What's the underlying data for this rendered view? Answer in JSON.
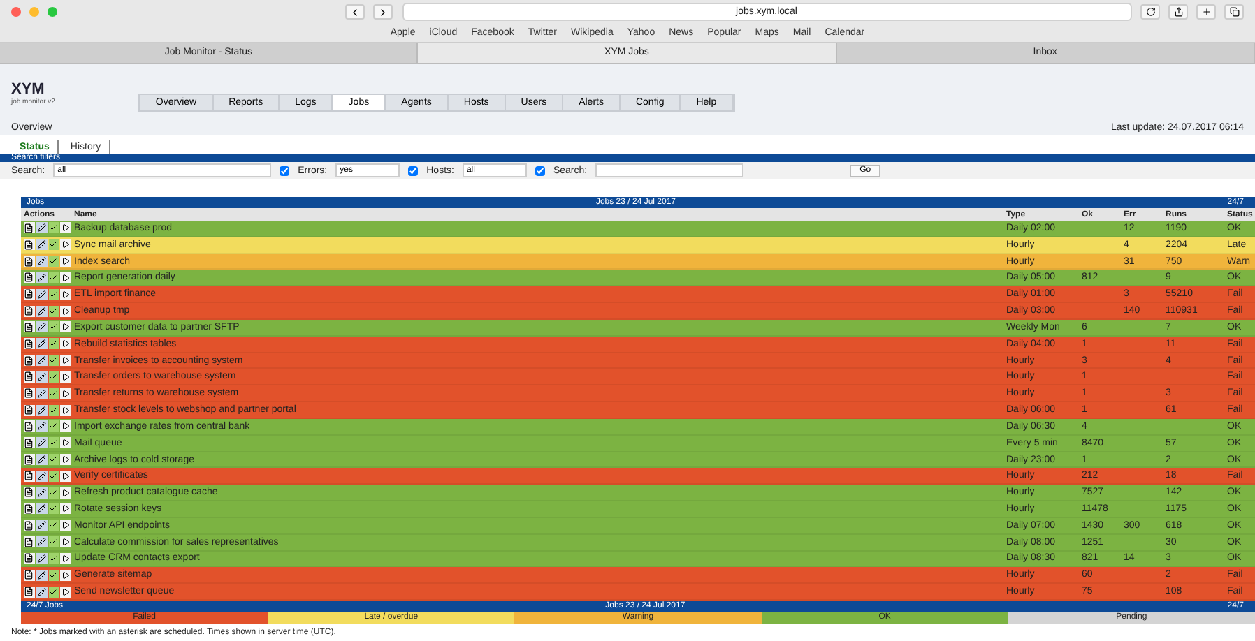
{
  "browser": {
    "url": "jobs.xym.local",
    "bookmarks": [
      "Apple",
      "iCloud",
      "Facebook",
      "Twitter",
      "Wikipedia",
      "Yahoo",
      "News",
      "Popular",
      "Maps",
      "Mail",
      "Calendar"
    ],
    "tabs": [
      {
        "title": "Job Monitor - Status",
        "selected": false
      },
      {
        "title": "XYM Jobs",
        "selected": true
      },
      {
        "title": "Inbox",
        "selected": false
      }
    ]
  },
  "header": {
    "logo": "XYM",
    "subtitle": "job monitor v2",
    "nav": [
      {
        "label": "Overview",
        "selected": false
      },
      {
        "label": "Reports",
        "selected": false
      },
      {
        "label": "Logs",
        "selected": false
      },
      {
        "label": "Jobs",
        "selected": true
      },
      {
        "label": "Agents",
        "selected": false
      },
      {
        "label": "Hosts",
        "selected": false
      },
      {
        "label": "Users",
        "selected": false
      },
      {
        "label": "Alerts",
        "selected": false
      },
      {
        "label": "Config",
        "selected": false
      },
      {
        "label": "Help",
        "selected": false
      }
    ]
  },
  "breadcrumb": "Overview",
  "last_update": "Last update: 24.07.2017 06:14",
  "subtabs": [
    {
      "label": "Status",
      "selected": true
    },
    {
      "label": "History",
      "selected": false
    }
  ],
  "filters": {
    "title": "Search filters",
    "search_label": "Search:",
    "search_value": "all",
    "checks": [
      {
        "label": "Errors:",
        "checked": true,
        "value": "yes"
      },
      {
        "label": "Hosts:",
        "checked": true,
        "value": "all"
      },
      {
        "label": "Search:",
        "checked": true
      }
    ],
    "go": "Go"
  },
  "table": {
    "title": "Jobs",
    "caption": "Jobs 23 / 24 Jul 2017",
    "right": "24/7",
    "columns": [
      "Actions",
      "Name",
      "Type",
      "Ok",
      "Err",
      "Runs",
      "Status"
    ],
    "rows": [
      {
        "name": "Backup database prod",
        "type": "Daily 02:00",
        "ok": "",
        "err": "12",
        "runs": "1190",
        "status": "OK",
        "color": "#7cb342"
      },
      {
        "name": "Sync mail archive",
        "type": "Hourly",
        "ok": "",
        "err": "4",
        "runs": "2204",
        "status": "Late",
        "color": "#f2dc5d"
      },
      {
        "name": "Index search",
        "type": "Hourly",
        "ok": "",
        "err": "31",
        "runs": "750",
        "status": "Warn",
        "color": "#f0b43c"
      },
      {
        "name": "Report generation daily",
        "type": "Daily 05:00",
        "ok": "812",
        "err": "",
        "runs": "9",
        "status": "OK",
        "color": "#7cb342"
      },
      {
        "name": "ETL import finance",
        "type": "Daily 01:00",
        "ok": "",
        "err": "3",
        "runs": "55210",
        "status": "Fail",
        "color": "#e2522b"
      },
      {
        "name": "Cleanup tmp",
        "type": "Daily 03:00",
        "ok": "",
        "err": "140",
        "runs": "110931",
        "status": "Fail",
        "color": "#e2522b"
      },
      {
        "name": "Export customer data to partner SFTP",
        "type": "Weekly Mon",
        "ok": "6",
        "err": "",
        "runs": "7",
        "status": "OK",
        "color": "#7cb342"
      },
      {
        "name": "Rebuild statistics tables",
        "type": "Daily 04:00",
        "ok": "1",
        "err": "",
        "runs": "11",
        "status": "Fail",
        "color": "#e2522b"
      },
      {
        "name": "Transfer invoices to accounting system",
        "type": "Hourly",
        "ok": "3",
        "err": "",
        "runs": "4",
        "status": "Fail",
        "color": "#e2522b"
      },
      {
        "name": "Transfer orders to warehouse system",
        "type": "Hourly",
        "ok": "1",
        "err": "",
        "runs": "",
        "status": "Fail",
        "color": "#e2522b"
      },
      {
        "name": "Transfer returns to warehouse system",
        "type": "Hourly",
        "ok": "1",
        "err": "",
        "runs": "3",
        "status": "Fail",
        "color": "#e2522b"
      },
      {
        "name": "Transfer stock levels to webshop and partner portal",
        "type": "Daily 06:00",
        "ok": "1",
        "err": "",
        "runs": "61",
        "status": "Fail",
        "color": "#e2522b"
      },
      {
        "name": "Import exchange rates from central bank",
        "type": "Daily 06:30",
        "ok": "4",
        "err": "",
        "runs": "",
        "status": "OK",
        "color": "#7cb342"
      },
      {
        "name": "Mail queue",
        "type": "Every 5 min",
        "ok": "8470",
        "err": "",
        "runs": "57",
        "status": "OK",
        "color": "#7cb342"
      },
      {
        "name": "Archive logs to cold storage",
        "type": "Daily 23:00",
        "ok": "1",
        "err": "",
        "runs": "2",
        "status": "OK",
        "color": "#7cb342"
      },
      {
        "name": "Verify certificates",
        "type": "Hourly",
        "ok": "212",
        "err": "",
        "runs": "18",
        "status": "Fail",
        "color": "#e2522b"
      },
      {
        "name": "Refresh product catalogue cache",
        "type": "Hourly",
        "ok": "7527",
        "err": "",
        "runs": "142",
        "status": "OK",
        "color": "#7cb342"
      },
      {
        "name": "Rotate session keys",
        "type": "Hourly",
        "ok": "11478",
        "err": "",
        "runs": "1175",
        "status": "OK",
        "color": "#7cb342"
      },
      {
        "name": "Monitor API endpoints",
        "type": "Daily 07:00",
        "ok": "1430",
        "err": "300",
        "runs": "618",
        "status": "OK",
        "color": "#7cb342"
      },
      {
        "name": "Calculate commission for sales representatives",
        "type": "Daily 08:00",
        "ok": "1251",
        "err": "",
        "runs": "30",
        "status": "OK",
        "color": "#7cb342"
      },
      {
        "name": "Update CRM contacts export",
        "type": "Daily 08:30",
        "ok": "821",
        "err": "14",
        "runs": "3",
        "status": "OK",
        "color": "#7cb342"
      },
      {
        "name": "Generate sitemap",
        "type": "Hourly",
        "ok": "60",
        "err": "",
        "runs": "2",
        "status": "Fail",
        "color": "#e2522b"
      },
      {
        "name": "Send newsletter queue",
        "type": "Hourly",
        "ok": "75",
        "err": "",
        "runs": "108",
        "status": "Fail",
        "color": "#e2522b"
      }
    ],
    "footer_left": "24/7 Jobs",
    "footer_caption": "Jobs 23 / 24 Jul 2017",
    "footer_right": "24/7"
  },
  "legend": [
    {
      "label": "Failed",
      "color": "#e2522b"
    },
    {
      "label": "Late / overdue",
      "color": "#f2dc5d"
    },
    {
      "label": "Warning",
      "color": "#f0b43c"
    },
    {
      "label": "OK",
      "color": "#7cb342"
    },
    {
      "label": "Pending",
      "color": "#d4d4d4"
    }
  ],
  "note": "Note: * Jobs marked with an asterisk are scheduled. Times shown in server time (UTC)."
}
